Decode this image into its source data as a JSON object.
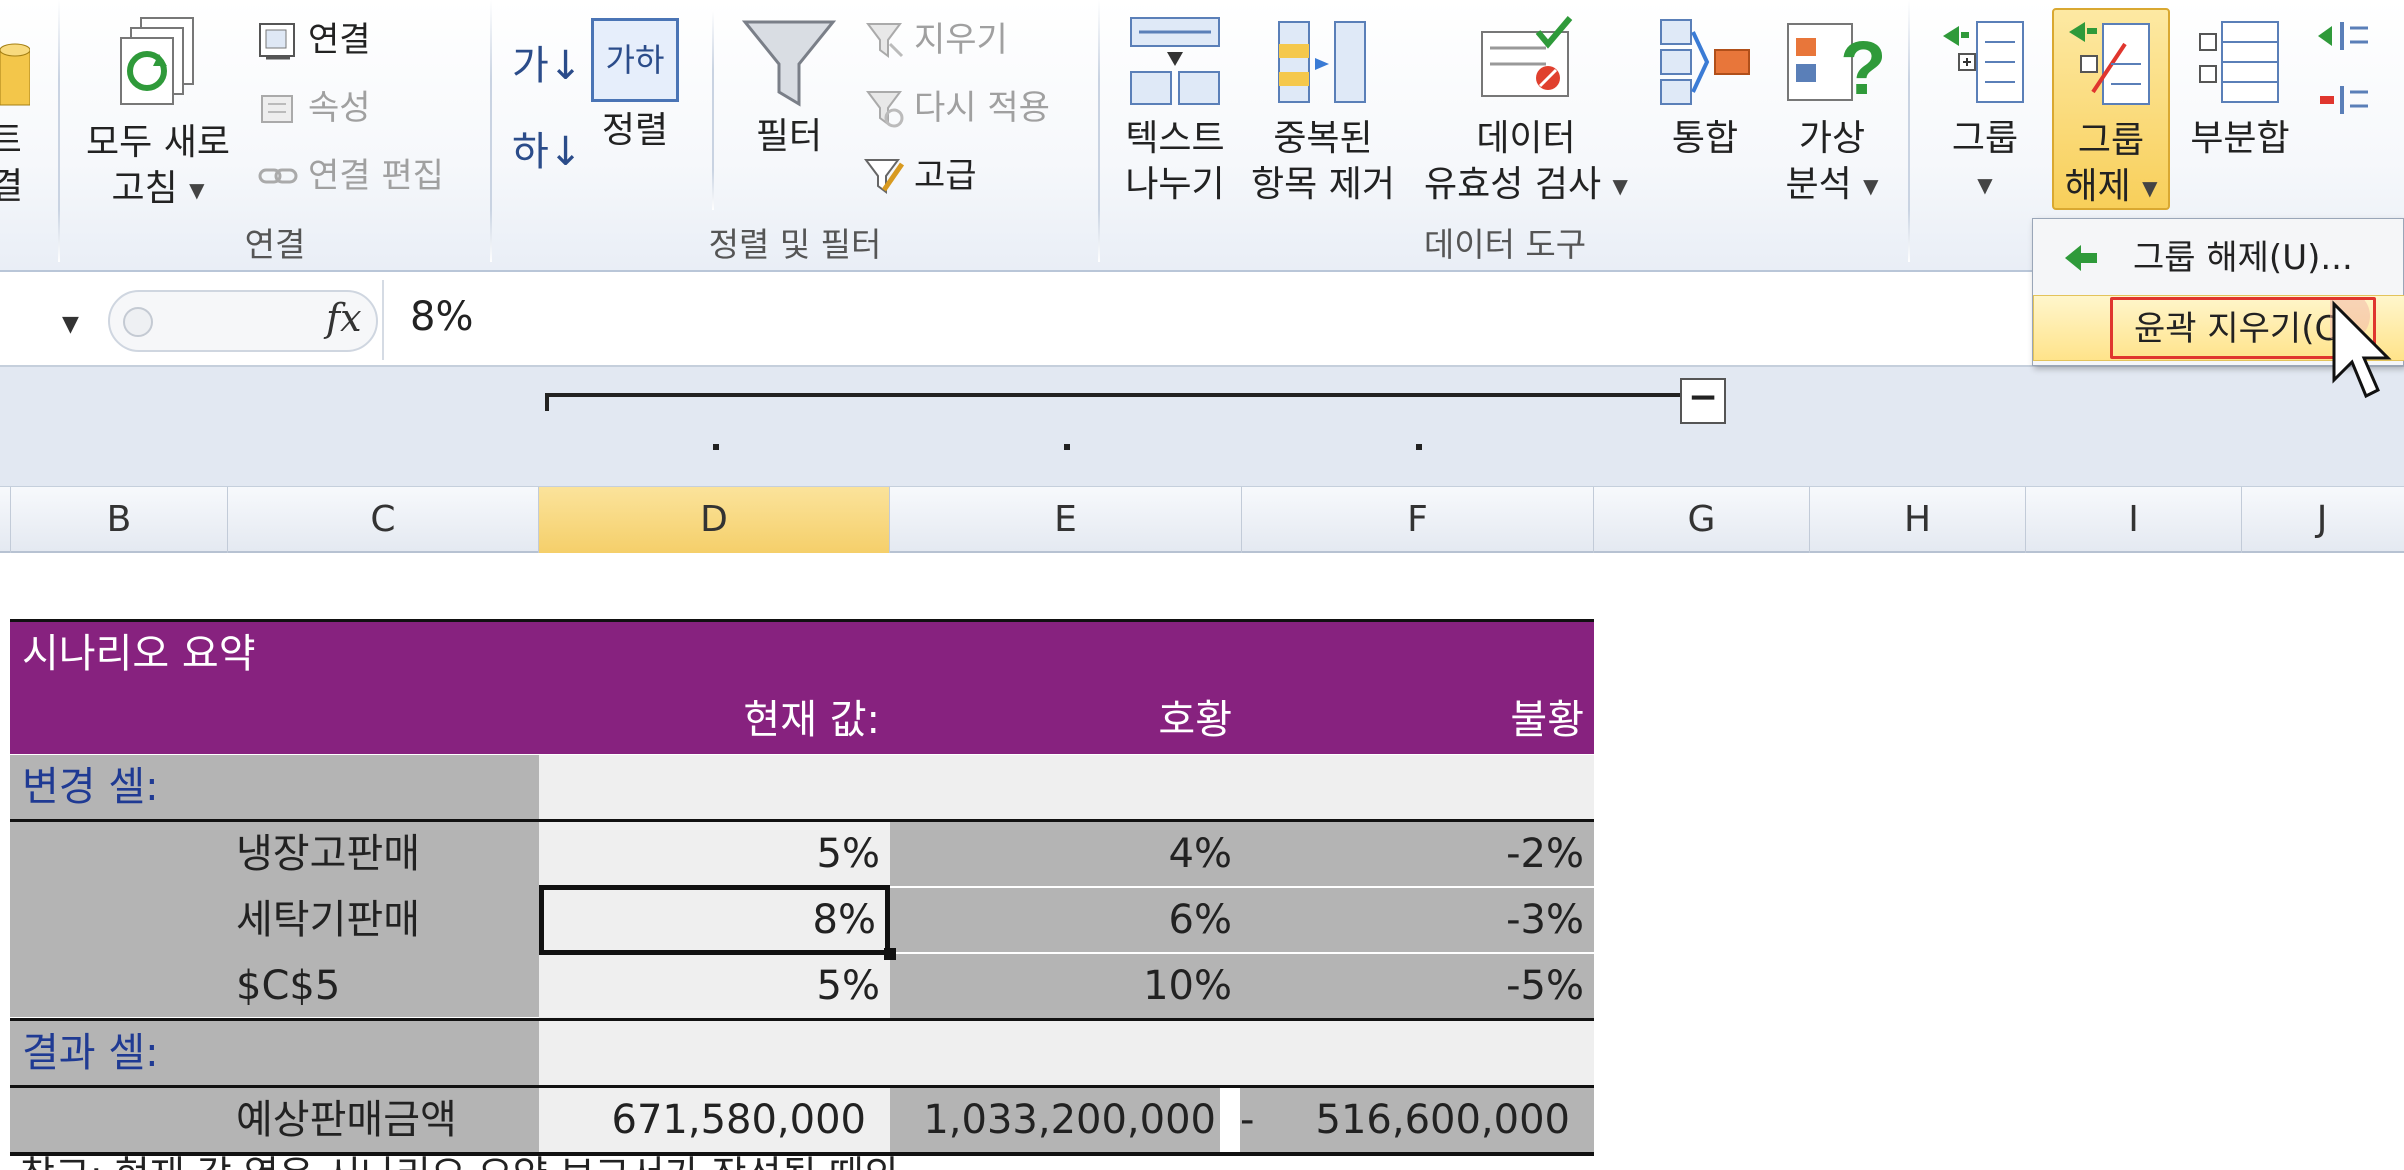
{
  "ribbon": {
    "edge_top": "트",
    "edge_bottom": "결",
    "refresh_all": {
      "line1": "모두 새로",
      "line2": "고침"
    },
    "connections": "연결",
    "properties": "속성",
    "edit_links": "연결 편집",
    "group_connections": "연결",
    "sort_az_glyph": "가↓",
    "sort_za_glyph": "하↓",
    "sort_icon_text": "가하",
    "sort": "정렬",
    "filter": "필터",
    "clear": "지우기",
    "reapply": "다시 적용",
    "advanced": "고급",
    "group_sort_filter": "정렬 및 필터",
    "text_to_columns": {
      "line1": "텍스트",
      "line2": "나누기"
    },
    "remove_duplicates": {
      "line1": "중복된",
      "line2": "항목 제거"
    },
    "data_validation": {
      "line1": "데이터",
      "line2": "유효성 검사"
    },
    "consolidate": "통합",
    "what_if": {
      "line1": "가상",
      "line2": "분석"
    },
    "group_data_tools": "데이터 도구",
    "group": "그룹",
    "ungroup": {
      "line1": "그룹",
      "line2": "해제"
    },
    "subtotal": "부분합"
  },
  "ungroup_menu": {
    "ungroup_item": "그룹 해제(U)...",
    "clear_outline_item": "윤곽 지우기(C)"
  },
  "formula_bar": {
    "fx": "fx",
    "value": "8%"
  },
  "columns": [
    "B",
    "C",
    "D",
    "E",
    "F",
    "G",
    "H",
    "I",
    "J"
  ],
  "table": {
    "title": "시나리오 요약",
    "header": {
      "current": "현재 값:",
      "good": "호황",
      "bad": "불황"
    },
    "changing_cells_label": "변경 셀:",
    "rows": [
      {
        "name": "냉장고판매",
        "current": "5%",
        "good": "4%",
        "bad": "-2%"
      },
      {
        "name": "세탁기판매",
        "current": "8%",
        "good": "6%",
        "bad": "-3%"
      },
      {
        "name": "$C$5",
        "current": "5%",
        "good": "10%",
        "bad": "-5%"
      }
    ],
    "result_cells_label": "결과 셀:",
    "result": {
      "name": "예상판매금액",
      "current": "671,580,000",
      "good": "1,033,200,000",
      "dash": "-",
      "bad": "516,600,000"
    },
    "note_cut": "참고: 현재 값 열은 시나리오 요약 보고서가 작성될 때의"
  }
}
